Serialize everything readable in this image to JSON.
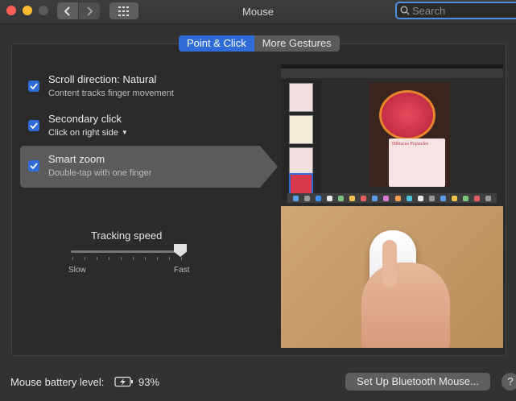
{
  "window": {
    "title": "Mouse"
  },
  "toolbar": {
    "search_placeholder": "Search"
  },
  "tabs": [
    {
      "label": "Point & Click",
      "active": true
    },
    {
      "label": "More Gestures",
      "active": false
    }
  ],
  "options": [
    {
      "title": "Scroll direction: Natural",
      "subtitle": "Content tracks finger movement",
      "checked": true,
      "selected": false,
      "has_dropdown": false
    },
    {
      "title": "Secondary click",
      "subtitle": "Click on right side",
      "checked": true,
      "selected": false,
      "has_dropdown": true
    },
    {
      "title": "Smart zoom",
      "subtitle": "Double-tap with one finger",
      "checked": true,
      "selected": true,
      "has_dropdown": false
    }
  ],
  "tracking": {
    "label": "Tracking speed",
    "min_label": "Slow",
    "max_label": "Fast",
    "value_fraction": 0.95
  },
  "preview": {
    "doc_title": "Hibiscus Popsicles"
  },
  "footer": {
    "battery_label": "Mouse battery level:",
    "battery_value": "93%",
    "bluetooth_button": "Set Up Bluetooth Mouse...",
    "help": "?"
  },
  "colors": {
    "accent": "#2f6cd7",
    "close": "#ff5f57",
    "minimize": "#febc2e"
  }
}
